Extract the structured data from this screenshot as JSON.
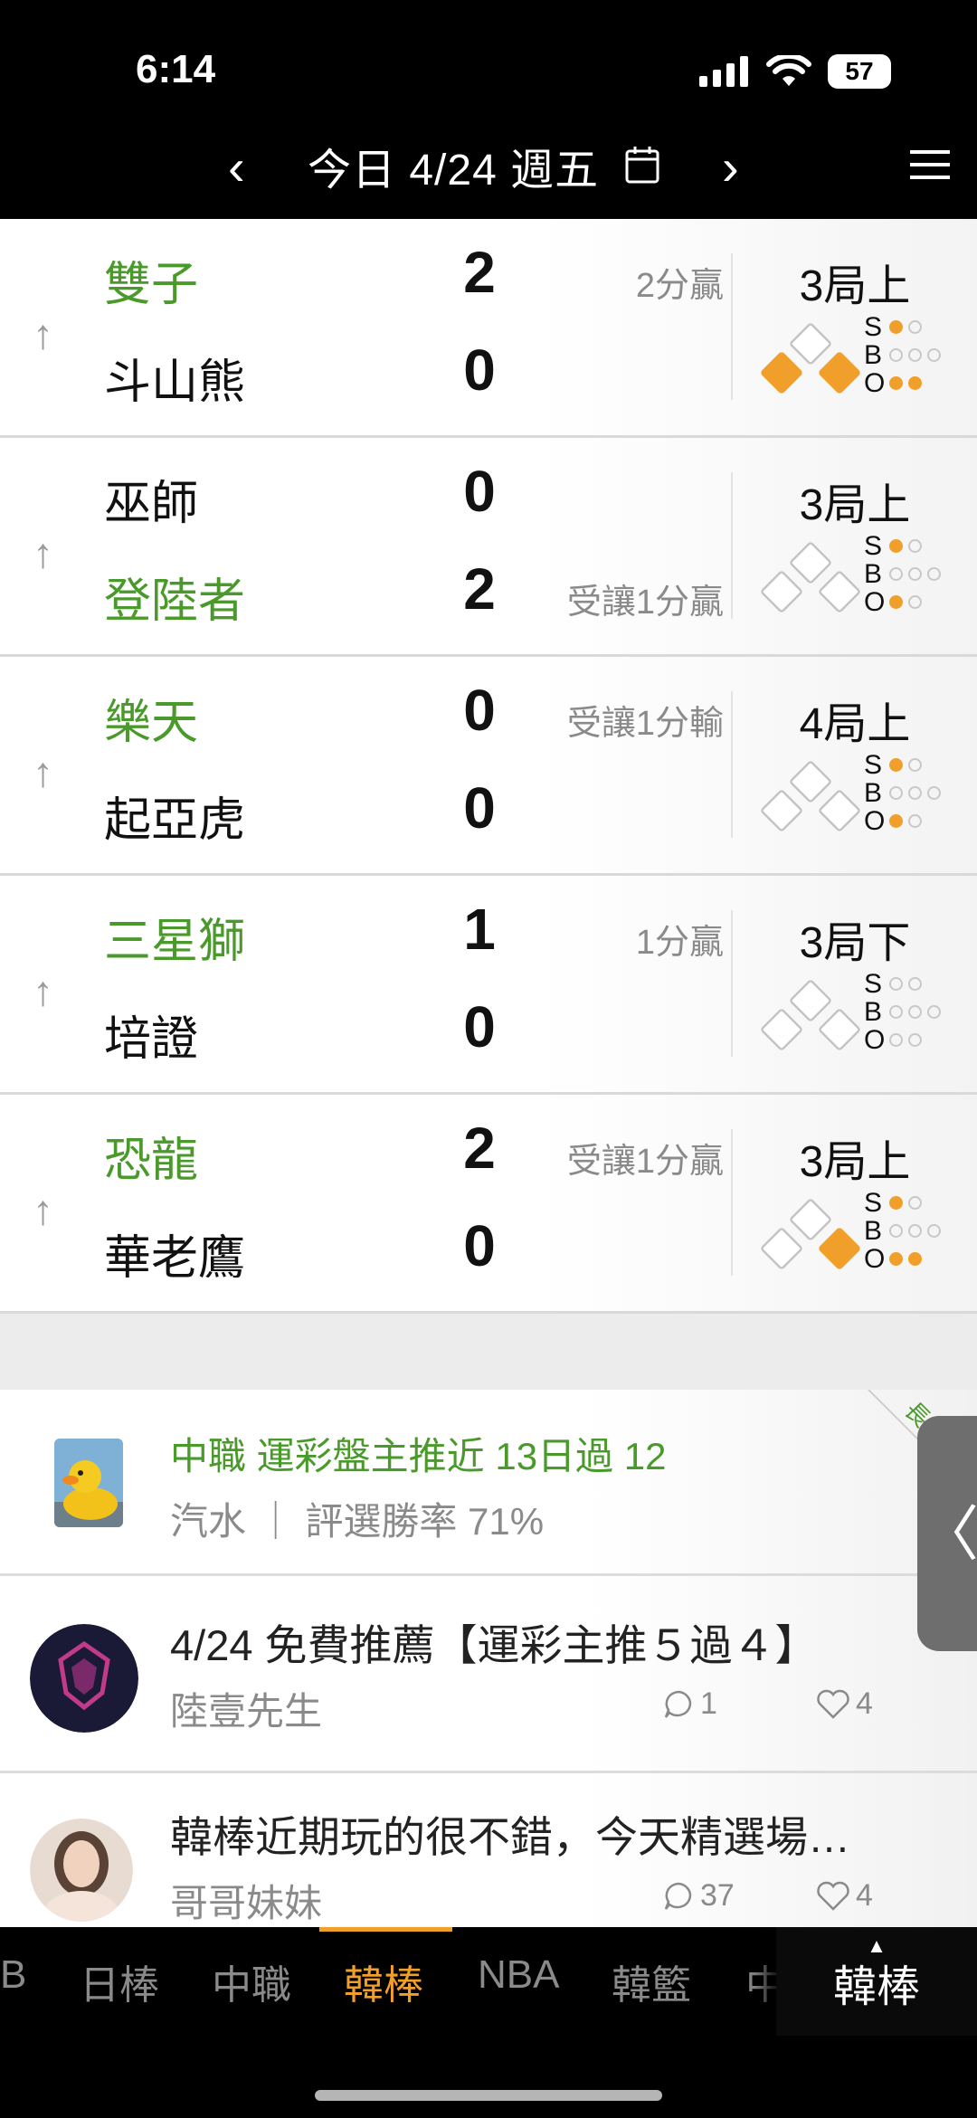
{
  "status_bar": {
    "time": "6:14",
    "battery": "57"
  },
  "date_nav": {
    "title": "今日 4/24 週五",
    "prev_icon": "chevron-left-icon",
    "next_icon": "chevron-right-icon"
  },
  "games": [
    {
      "team1": "雙子",
      "score1": "2",
      "result1": "2分贏",
      "team2": "斗山熊",
      "score2": "0",
      "result2": "",
      "winner": 1,
      "inning": "3局上",
      "bases": [
        true,
        false,
        true
      ],
      "sbo": {
        "S": 1,
        "B": 0,
        "O": 2
      }
    },
    {
      "team1": "巫師",
      "score1": "0",
      "result1": "",
      "team2": "登陸者",
      "score2": "2",
      "result2": "受讓1分贏",
      "winner": 2,
      "inning": "3局上",
      "bases": [
        false,
        false,
        false
      ],
      "sbo": {
        "S": 1,
        "B": 0,
        "O": 1
      }
    },
    {
      "team1": "樂天",
      "score1": "0",
      "result1": "受讓1分輸",
      "team2": "起亞虎",
      "score2": "0",
      "result2": "",
      "winner": 1,
      "inning": "4局上",
      "bases": [
        false,
        false,
        false
      ],
      "sbo": {
        "S": 1,
        "B": 0,
        "O": 1
      }
    },
    {
      "team1": "三星獅",
      "score1": "1",
      "result1": "1分贏",
      "team2": "培證",
      "score2": "0",
      "result2": "",
      "winner": 1,
      "inning": "3局下",
      "bases": [
        false,
        false,
        false
      ],
      "sbo": {
        "S": 0,
        "B": 0,
        "O": 0
      }
    },
    {
      "team1": "恐龍",
      "score1": "2",
      "result1": "受讓1分贏",
      "team2": "華老鷹",
      "score2": "0",
      "result2": "",
      "winner": 1,
      "inning": "3局上",
      "bases": [
        true,
        false,
        false
      ],
      "sbo": {
        "S": 1,
        "B": 0,
        "O": 2
      }
    }
  ],
  "posts": [
    {
      "title": "中職 運彩盤主推近 13日過 12",
      "author": "汽水 ｜ 評選勝率 71%",
      "tag": "長期",
      "avatar_icon": "duck-avatar"
    },
    {
      "title": "4/24 免費推薦【運彩主推５過４】",
      "author": "陸壹先生",
      "comments": "1",
      "likes": "4",
      "avatar_icon": "emblem-avatar"
    },
    {
      "title": "韓棒近期玩的很不錯，今天精選場…",
      "author": "哥哥妹妹",
      "comments": "37",
      "likes": "4",
      "avatar_icon": "person-avatar"
    }
  ],
  "side_tab_label": "〈",
  "bottom_tabs": {
    "items": [
      "B",
      "日棒",
      "中職",
      "韓棒",
      "NBA",
      "韓籃",
      "中"
    ],
    "active": "韓棒",
    "current": "韓棒"
  },
  "colors": {
    "win_green": "#4a9a2b",
    "accent_orange": "#f0a02a"
  }
}
